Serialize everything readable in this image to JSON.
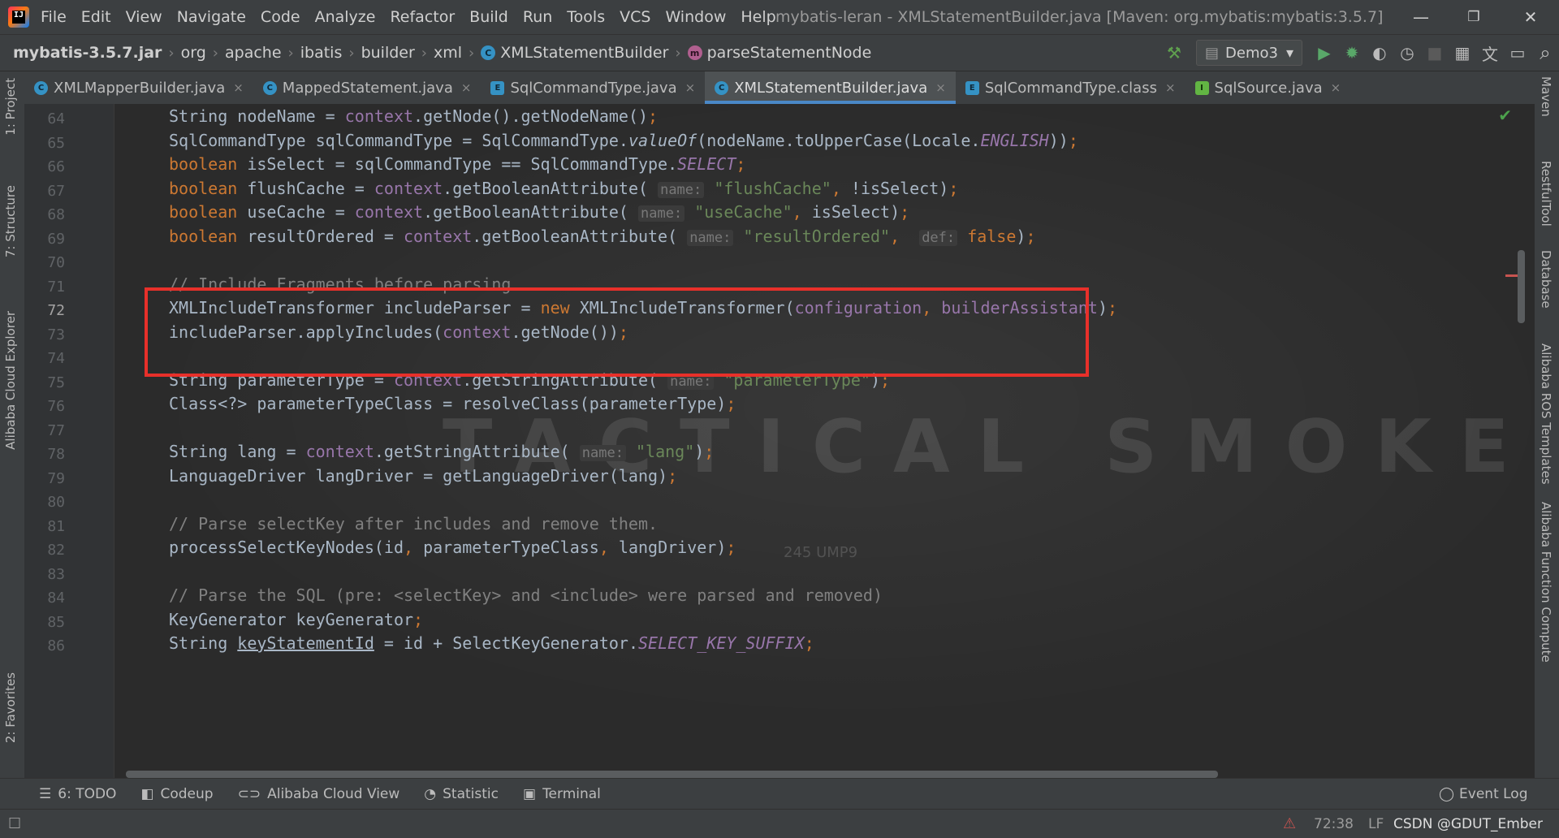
{
  "window": {
    "logo_text": "IJ",
    "title": "mybatis-leran - XMLStatementBuilder.java [Maven: org.mybatis:mybatis:3.5.7]",
    "minimize": "—",
    "restore": "❐",
    "close": "✕"
  },
  "menu": [
    "File",
    "Edit",
    "View",
    "Navigate",
    "Code",
    "Analyze",
    "Refactor",
    "Build",
    "Run",
    "Tools",
    "VCS",
    "Window",
    "Help"
  ],
  "breadcrumb": {
    "jar": "mybatis-3.5.7.jar",
    "segments": [
      "org",
      "apache",
      "ibatis",
      "builder",
      "xml"
    ],
    "class_name": "XMLStatementBuilder",
    "method_name": "parseStatementNode",
    "class_icon": "C",
    "method_icon": "m",
    "separator": "›"
  },
  "toolbar": {
    "run_config": "Demo3",
    "icons": [
      "hammer-icon",
      "run-icon",
      "debug-icon",
      "coverage-icon",
      "profile-icon",
      "stop-icon",
      "project-structure-icon",
      "translate-icon",
      "terminal-icon",
      "search-icon"
    ],
    "glyphs": {
      "hammer": "⚒",
      "config": "▤",
      "dropdown": "▾",
      "run": "▶",
      "debug": "✹",
      "coverage": "◐",
      "profile": "◷",
      "stop": "■",
      "project_structure": "▦",
      "translate": "文",
      "terminal": "▭",
      "search": "⌕"
    }
  },
  "tabs": [
    {
      "label": "XMLMapperBuilder.java",
      "icon": "C",
      "kind": "c",
      "active": false
    },
    {
      "label": "MappedStatement.java",
      "icon": "C",
      "kind": "c",
      "active": false
    },
    {
      "label": "SqlCommandType.java",
      "icon": "E",
      "kind": "e",
      "active": false
    },
    {
      "label": "XMLStatementBuilder.java",
      "icon": "C",
      "kind": "c",
      "active": true
    },
    {
      "label": "SqlCommandType.class",
      "icon": "E",
      "kind": "e",
      "active": false
    },
    {
      "label": "SqlSource.java",
      "icon": "I",
      "kind": "i",
      "active": false
    }
  ],
  "tab_close_glyph": "×",
  "left_tools": [
    "1: Project",
    "7: Structure",
    "Alibaba Cloud Explorer",
    "2: Favorites"
  ],
  "right_tools": [
    "Maven",
    "RestfulTool",
    "Database",
    "Alibaba ROS Templates",
    "Alibaba Function Compute"
  ],
  "editor": {
    "first_line": 64,
    "current_line": 72,
    "watermark": "TACTICAL SMOKE",
    "faint_overlay": "245 UMP9",
    "highlight_lines": [
      71,
      73
    ],
    "check_glyph": "✔",
    "lines": [
      [
        {
          "t": "String nodeName = "
        },
        {
          "t": "context",
          "c": "field"
        },
        {
          "t": ".getNode().getNodeName()"
        },
        {
          "t": ";",
          "c": "punc"
        }
      ],
      [
        {
          "t": "SqlCommandType sqlCommandType = SqlCommandType."
        },
        {
          "t": "valueOf",
          "c": "italic"
        },
        {
          "t": "(nodeName.toUpperCase(Locale."
        },
        {
          "t": "ENGLISH",
          "c": "italic-static"
        },
        {
          "t": "))"
        },
        {
          "t": ";",
          "c": "punc"
        }
      ],
      [
        {
          "t": "boolean ",
          "c": "kw"
        },
        {
          "t": "isSelect = sqlCommandType == SqlCommandType."
        },
        {
          "t": "SELECT",
          "c": "italic-static"
        },
        {
          "t": ";",
          "c": "punc"
        }
      ],
      [
        {
          "t": "boolean ",
          "c": "kw"
        },
        {
          "t": "flushCache = "
        },
        {
          "t": "context",
          "c": "field"
        },
        {
          "t": ".getBooleanAttribute( "
        },
        {
          "t": "name:",
          "c": "hint"
        },
        {
          "t": " "
        },
        {
          "t": "\"flushCache\"",
          "c": "str"
        },
        {
          "t": ", ",
          "c": "punc"
        },
        {
          "t": "!isSelect)"
        },
        {
          "t": ";",
          "c": "punc"
        }
      ],
      [
        {
          "t": "boolean ",
          "c": "kw"
        },
        {
          "t": "useCache = "
        },
        {
          "t": "context",
          "c": "field"
        },
        {
          "t": ".getBooleanAttribute( "
        },
        {
          "t": "name:",
          "c": "hint"
        },
        {
          "t": " "
        },
        {
          "t": "\"useCache\"",
          "c": "str"
        },
        {
          "t": ", ",
          "c": "punc"
        },
        {
          "t": "isSelect)"
        },
        {
          "t": ";",
          "c": "punc"
        }
      ],
      [
        {
          "t": "boolean ",
          "c": "kw"
        },
        {
          "t": "resultOrdered = "
        },
        {
          "t": "context",
          "c": "field"
        },
        {
          "t": ".getBooleanAttribute( "
        },
        {
          "t": "name:",
          "c": "hint"
        },
        {
          "t": " "
        },
        {
          "t": "\"resultOrdered\"",
          "c": "str"
        },
        {
          "t": ", ",
          "c": "punc"
        },
        {
          "t": " "
        },
        {
          "t": "def:",
          "c": "hint"
        },
        {
          "t": " "
        },
        {
          "t": "false",
          "c": "kw"
        },
        {
          "t": ")"
        },
        {
          "t": ";",
          "c": "punc"
        }
      ],
      [],
      [
        {
          "t": "// Include Fragments before parsing",
          "c": "cmt"
        }
      ],
      [
        {
          "t": "XMLIncludeTransformer includeParser = "
        },
        {
          "t": "new ",
          "c": "kw"
        },
        {
          "t": "XMLIncludeTransformer("
        },
        {
          "t": "configuration",
          "c": "field"
        },
        {
          "t": ", ",
          "c": "punc"
        },
        {
          "t": "builderAssistant",
          "c": "field"
        },
        {
          "t": ")"
        },
        {
          "t": ";",
          "c": "punc"
        }
      ],
      [
        {
          "t": "includeParser.applyIncludes("
        },
        {
          "t": "context",
          "c": "field"
        },
        {
          "t": ".getNode())"
        },
        {
          "t": ";",
          "c": "punc"
        }
      ],
      [],
      [
        {
          "t": "String parameterType = "
        },
        {
          "t": "context",
          "c": "field"
        },
        {
          "t": ".getStringAttribute( "
        },
        {
          "t": "name:",
          "c": "hint"
        },
        {
          "t": " "
        },
        {
          "t": "\"parameterType\"",
          "c": "str"
        },
        {
          "t": ")"
        },
        {
          "t": ";",
          "c": "punc"
        }
      ],
      [
        {
          "t": "Class<?> parameterTypeClass = resolveClass(parameterType)"
        },
        {
          "t": ";",
          "c": "punc"
        }
      ],
      [],
      [
        {
          "t": "String lang = "
        },
        {
          "t": "context",
          "c": "field"
        },
        {
          "t": ".getStringAttribute( "
        },
        {
          "t": "name:",
          "c": "hint"
        },
        {
          "t": " "
        },
        {
          "t": "\"lang\"",
          "c": "str"
        },
        {
          "t": ")"
        },
        {
          "t": ";",
          "c": "punc"
        }
      ],
      [
        {
          "t": "LanguageDriver langDriver = getLanguageDriver(lang)"
        },
        {
          "t": ";",
          "c": "punc"
        }
      ],
      [],
      [
        {
          "t": "// Parse selectKey after includes and remove them.",
          "c": "cmt"
        }
      ],
      [
        {
          "t": "processSelectKeyNodes(id"
        },
        {
          "t": ", ",
          "c": "punc"
        },
        {
          "t": "parameterTypeClass"
        },
        {
          "t": ", ",
          "c": "punc"
        },
        {
          "t": "langDriver)"
        },
        {
          "t": ";",
          "c": "punc"
        }
      ],
      [],
      [
        {
          "t": "// Parse the SQL (pre: <selectKey> and <include> were parsed and removed)",
          "c": "cmt"
        }
      ],
      [
        {
          "t": "KeyGenerator keyGenerator"
        },
        {
          "t": ";",
          "c": "punc"
        }
      ],
      [
        {
          "t": "String "
        },
        {
          "t": "keyStatementId",
          "c": "underline"
        },
        {
          "t": " = id + SelectKeyGenerator."
        },
        {
          "t": "SELECT_KEY_SUFFIX",
          "c": "italic-static"
        },
        {
          "t": ";",
          "c": "punc"
        }
      ]
    ]
  },
  "bottom_tools": [
    {
      "label": "6: TODO",
      "icon": "☰"
    },
    {
      "label": "Codeup",
      "icon": "◧"
    },
    {
      "label": "Alibaba Cloud View",
      "icon": "⊂⊃"
    },
    {
      "label": "Statistic",
      "icon": "◔"
    },
    {
      "label": "Terminal",
      "icon": "▣"
    }
  ],
  "event_log": {
    "label": "Event Log",
    "icon": "◯"
  },
  "status": {
    "left_icon": "☐",
    "alert_icon": "⚠",
    "position": "72:38",
    "line_sep": "LF",
    "watermark_text": "CSDN @GDUT_Ember"
  }
}
